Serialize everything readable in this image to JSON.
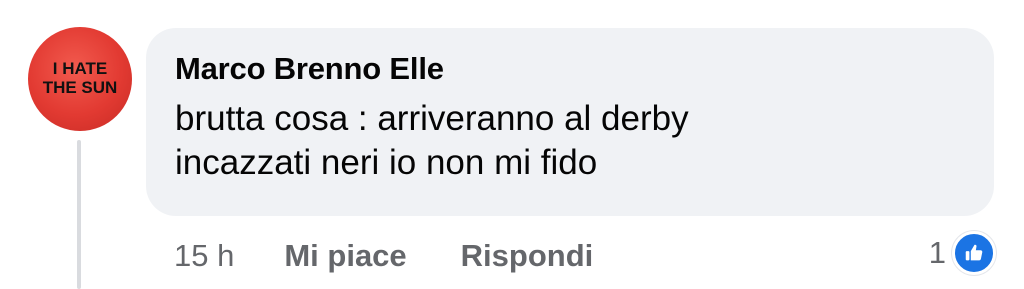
{
  "comment": {
    "avatar_text_line1": "I HATE",
    "avatar_text_line2": "THE SUN",
    "author": "Marco Brenno Elle",
    "text_line1": "brutta cosa : arriveranno al derby",
    "text_line2": "incazzati neri io non mi fido",
    "timestamp": "15 h",
    "like_label": "Mi piace",
    "reply_label": "Rispondi",
    "reaction_count": "1",
    "reaction_icon": "thumbs-up-icon"
  },
  "colors": {
    "bubble_bg": "#f0f2f5",
    "secondary_text": "#65676b",
    "like_blue": "#1b74e4",
    "avatar_red": "#e23a32"
  }
}
